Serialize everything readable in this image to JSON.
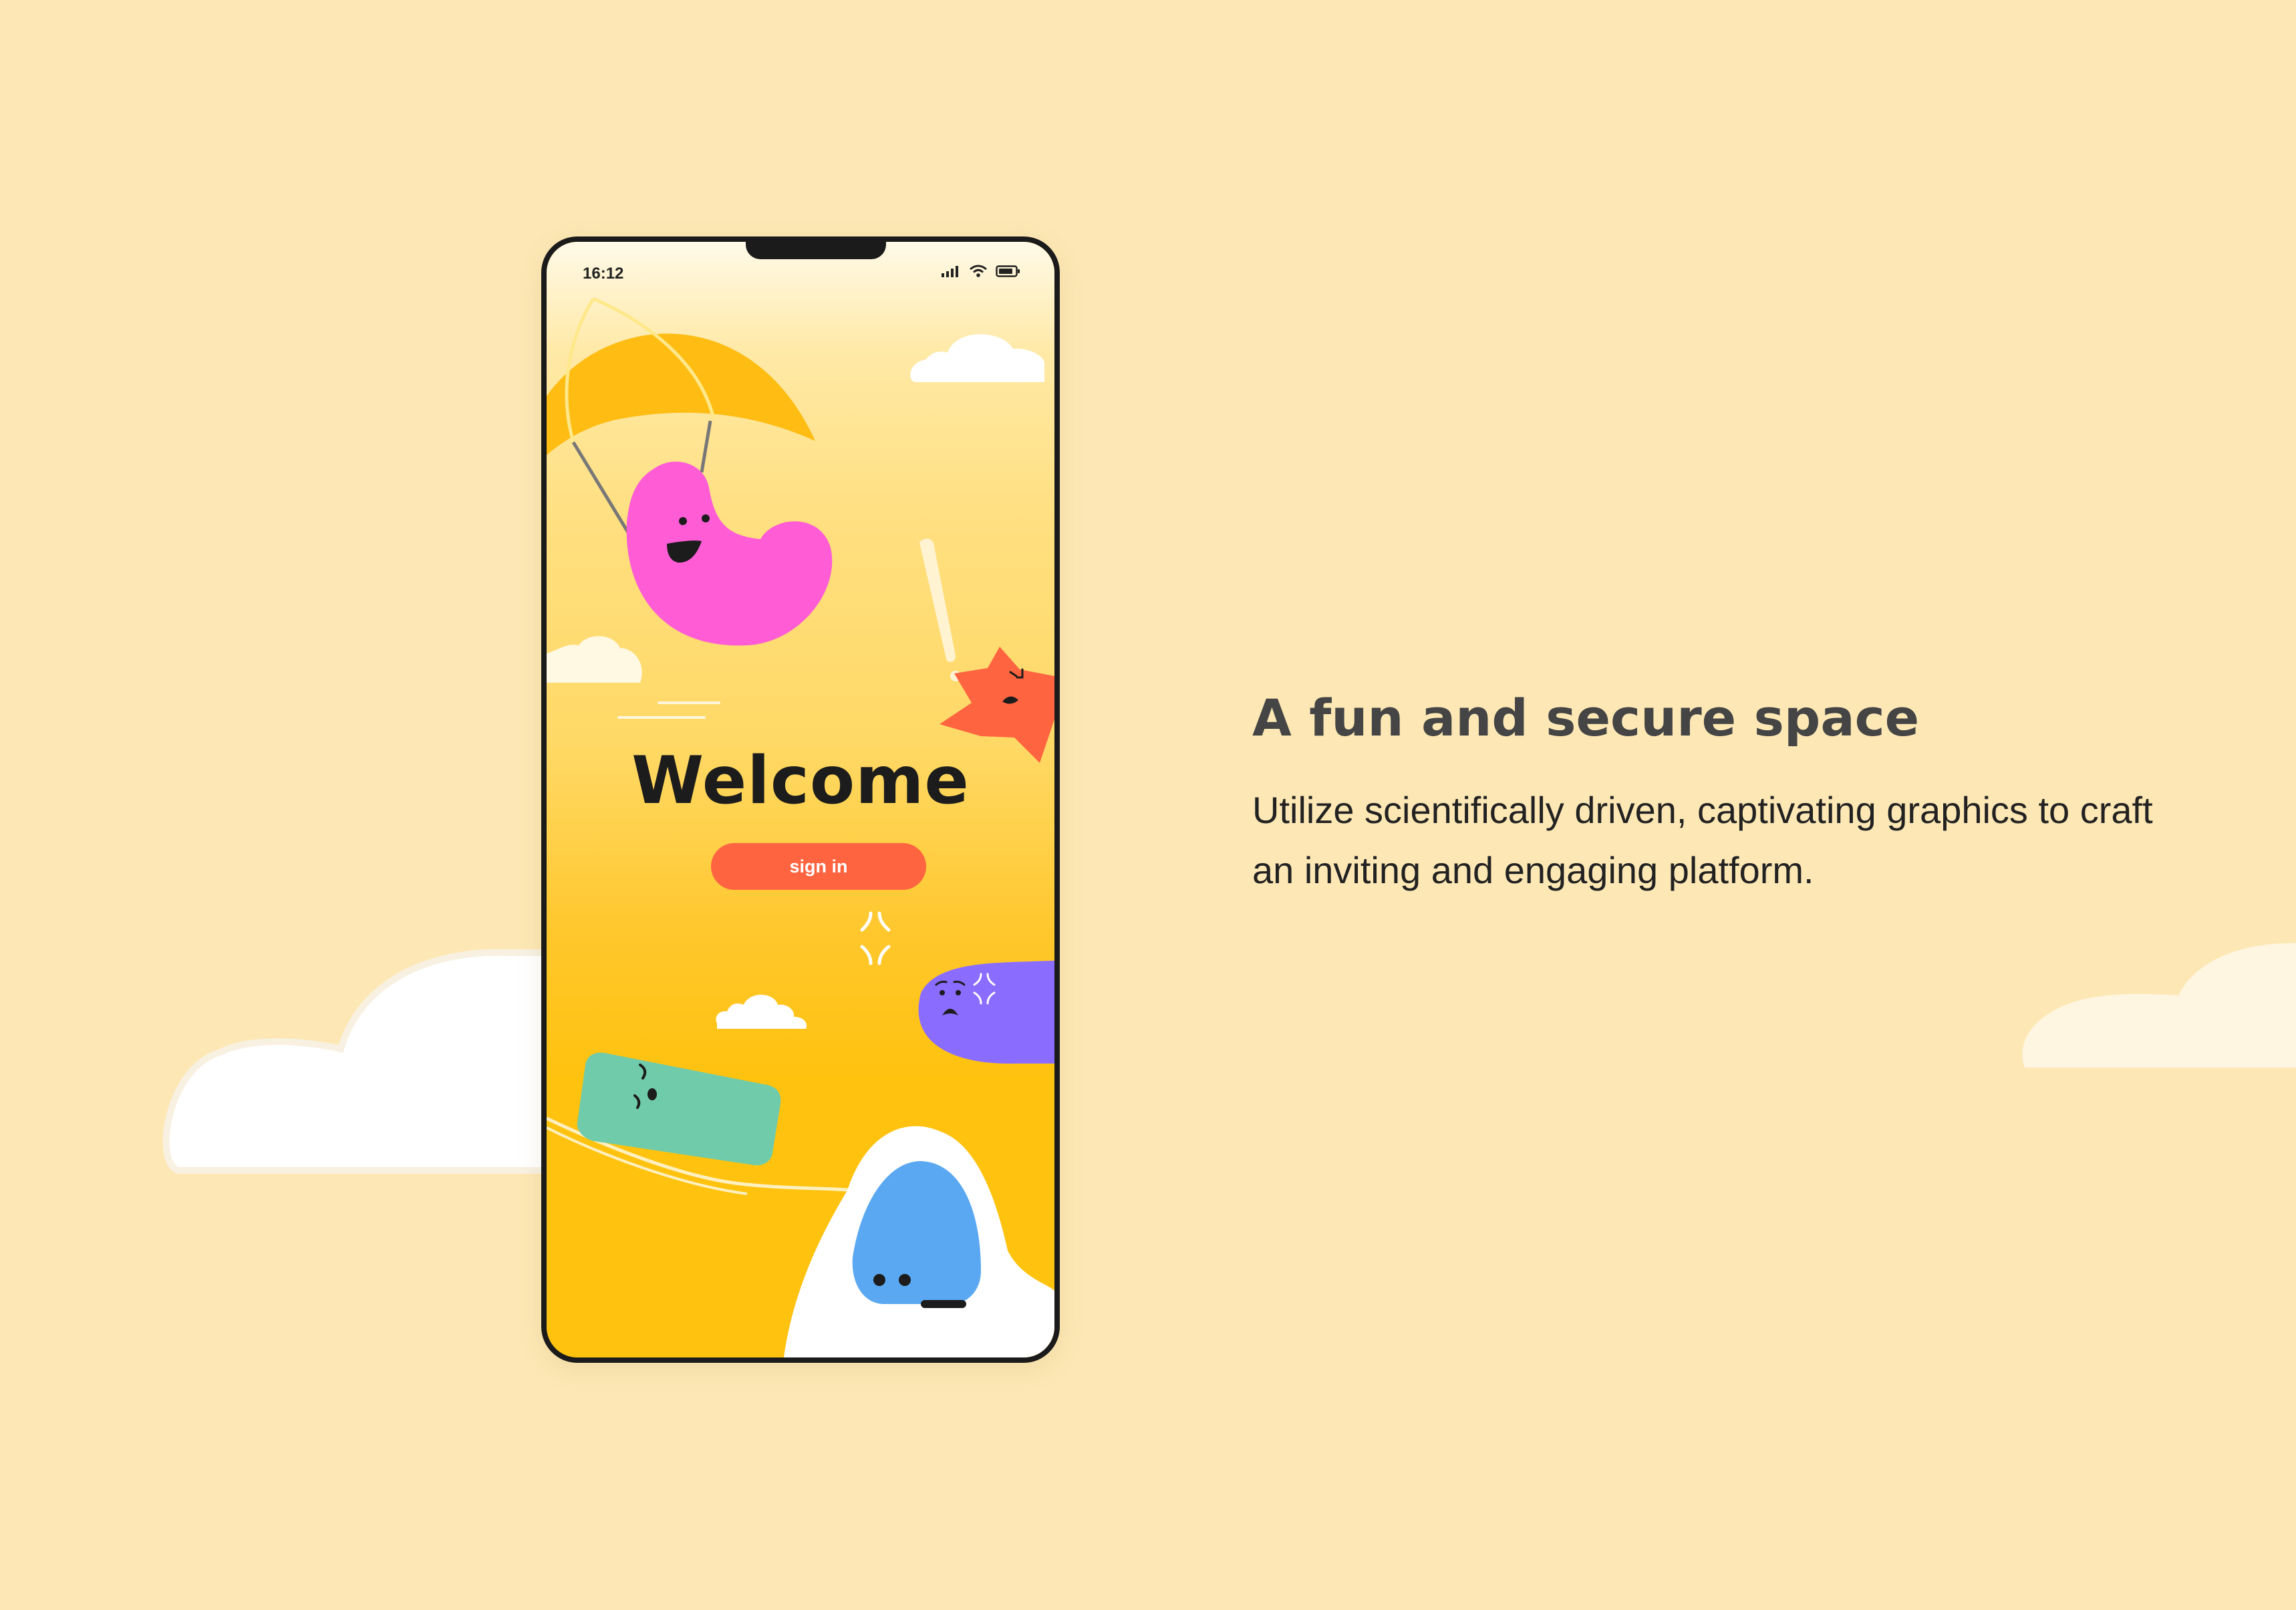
{
  "status_bar": {
    "time": "16:12"
  },
  "welcome": {
    "title": "Welcome",
    "sign_in_label": "sign in"
  },
  "marketing": {
    "headline": "A fun and secure space",
    "description": "Utilize scientifically driven, captivating graphics to craft an inviting and engaging platform."
  },
  "colors": {
    "background": "#FDE8B5",
    "screen_yellow": "#FFC20F",
    "button": "#FF6440",
    "pink_character": "#FF5CD6",
    "star_character": "#FF6440",
    "purple_character": "#8A6CFF",
    "green_character": "#6FCBAA",
    "blue_character": "#5BA8F2",
    "headline_text": "#454545"
  }
}
